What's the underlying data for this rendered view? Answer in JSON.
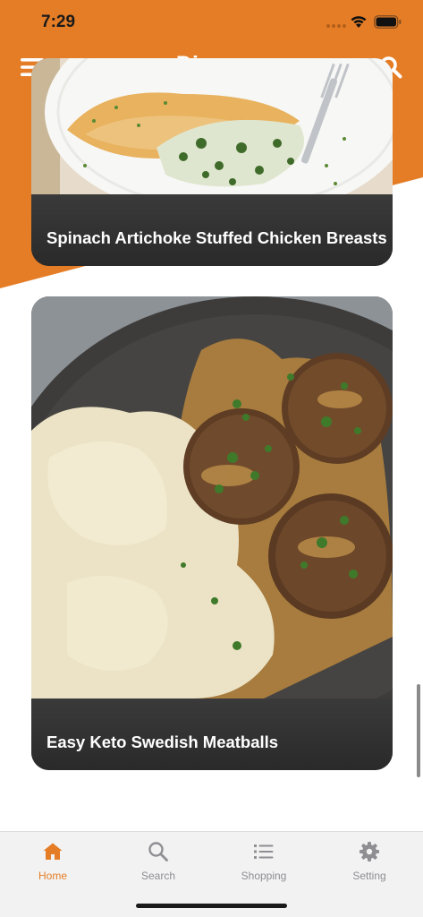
{
  "status_bar": {
    "time": "7:29",
    "icons": [
      "signal-dots-icon",
      "wifi-icon",
      "battery-icon"
    ]
  },
  "nav": {
    "title": "Dinner",
    "left_icon": "menu-icon",
    "right_icon": "search-icon"
  },
  "colors": {
    "accent": "#e57d26",
    "card_caption": "#2e2e2e",
    "tab_inactive": "#8e8e93"
  },
  "recipes": [
    {
      "title": "Spinach Artichoke Stuffed Chicken Breasts",
      "image": "stuffed-chicken-photo"
    },
    {
      "title": "Easy Keto Swedish Meatballs",
      "image": "meatballs-mashed-potatoes-photo"
    }
  ],
  "tabs": [
    {
      "label": "Home",
      "icon": "home-icon",
      "active": true
    },
    {
      "label": "Search",
      "icon": "search-icon",
      "active": false
    },
    {
      "label": "Shopping",
      "icon": "list-icon",
      "active": false
    },
    {
      "label": "Setting",
      "icon": "gear-icon",
      "active": false
    }
  ]
}
